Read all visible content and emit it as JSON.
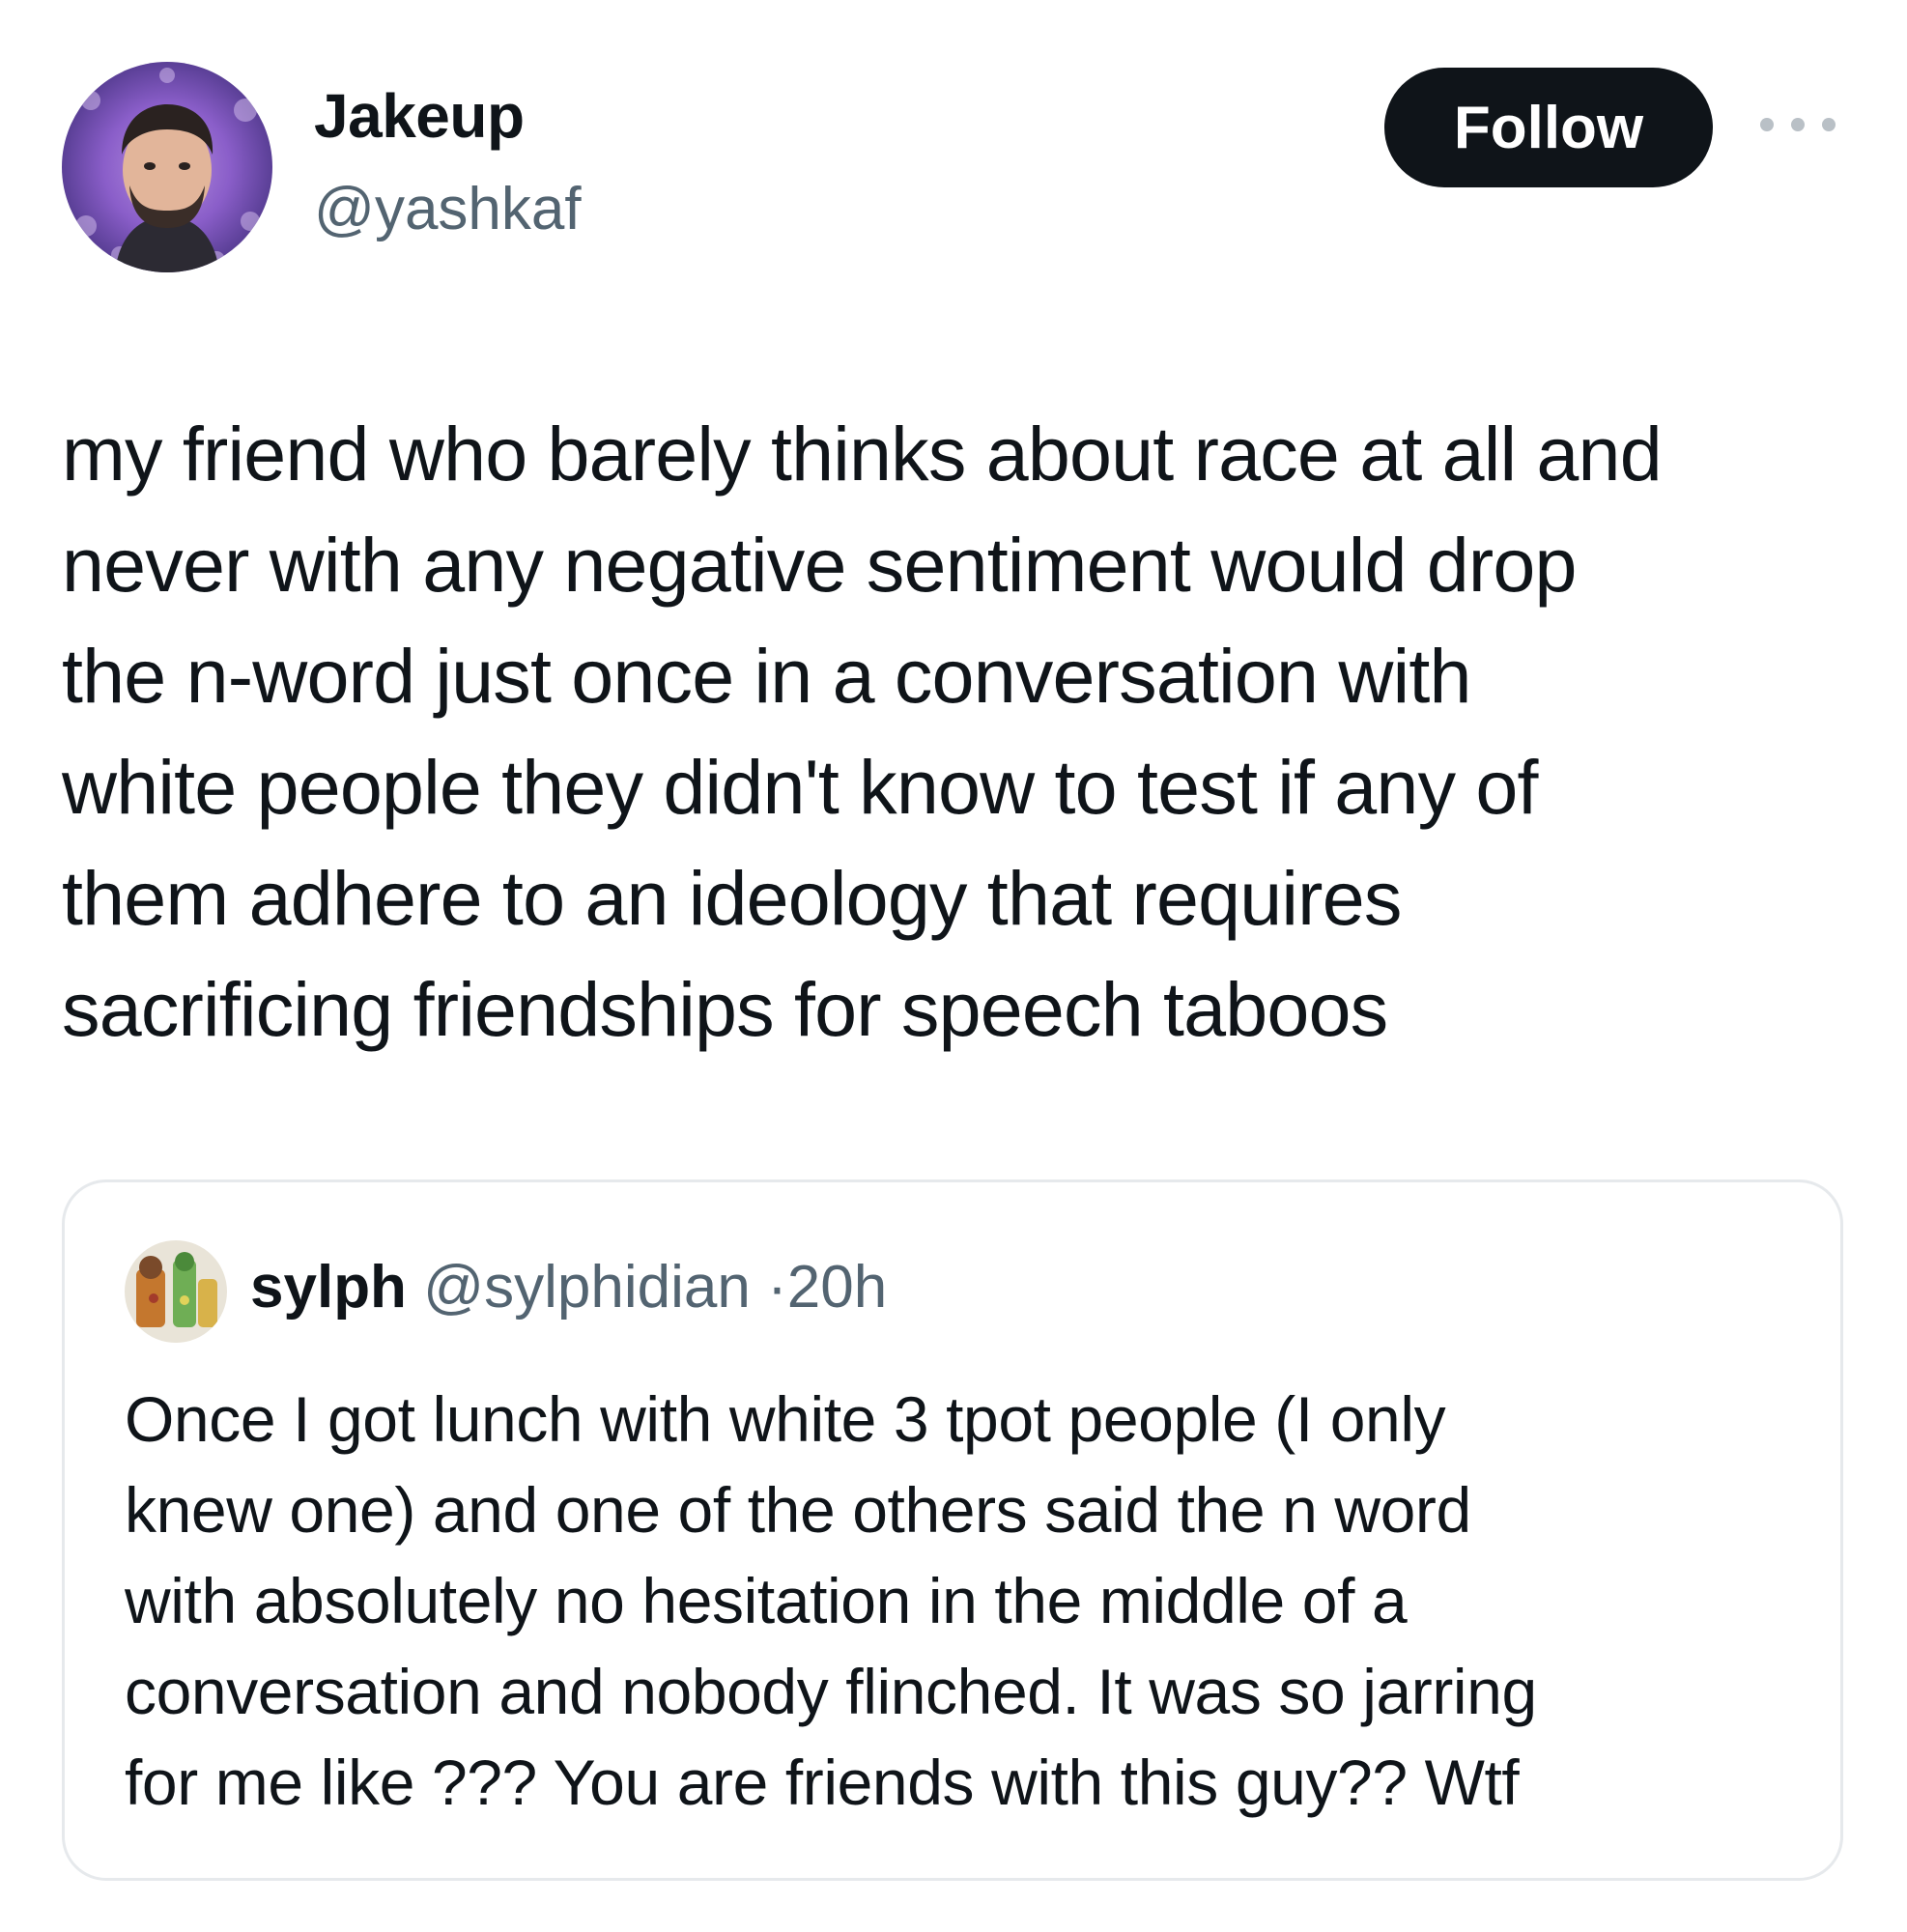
{
  "tweet": {
    "author": {
      "name": "Jakeup",
      "handle": "@yashkaf"
    },
    "follow_label": "Follow",
    "text": "my friend who barely thinks about race at all and\nnever with any negative sentiment would drop\nthe n-word just once in a conversation with\nwhite people they didn't know to test if any of\nthem adhere to an ideology that requires\nsacrificing friendships for speech taboos"
  },
  "quoted_tweet": {
    "author": {
      "name": "sylph",
      "handle": "@sylphidian"
    },
    "separator": "·",
    "time": "20h",
    "text": "Once I got lunch with white 3 tpot people (I only\nknew one) and one of the others said the n word\nwith absolutely no hesitation in the middle of a\nconversation and nobody flinched. It was so jarring\nfor me like ??? You are friends with this guy?? Wtf"
  },
  "icons": {
    "more": "more-horizontal-icon",
    "avatar": "profile-photo",
    "quote_avatar": "profile-photo"
  },
  "colors": {
    "primary_text": "#0f1419",
    "secondary_text": "#536471",
    "follow_button_bg": "#0f1419",
    "follow_button_text": "#ffffff",
    "card_border": "#e6e9ec"
  }
}
